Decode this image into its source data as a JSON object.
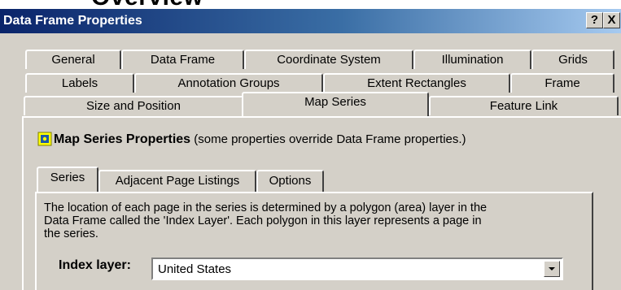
{
  "heading_cut": "Overview",
  "window": {
    "title": "Data Frame Properties",
    "help_label": "?",
    "close_label": "X",
    "title_color": "#0a246a"
  },
  "tabs": {
    "row1": [
      "General",
      "Data Frame",
      "Coordinate System",
      "Illumination",
      "Grids"
    ],
    "row2": [
      "Labels",
      "Annotation Groups",
      "Extent Rectangles",
      "Frame"
    ],
    "row3": [
      "Size and Position",
      "Map Series",
      "Feature Link"
    ],
    "active": "Map Series"
  },
  "map_series": {
    "title_bold": "Map Series Properties",
    "title_note": " (some properties override Data Frame properties.)",
    "subtabs": [
      "Series",
      "Adjacent Page Listings",
      "Options"
    ],
    "active_subtab": "Series",
    "description_lines": [
      "The location of each page in the series is determined by a polygon (area) layer in the",
      "Data Frame called the 'Index Layer'.  Each polygon in this layer represents a page in",
      "the series."
    ],
    "index_layer_label": "Index layer:",
    "index_layer_value": "United States"
  },
  "icons": {
    "map_series": "map-series-icon",
    "dropdown": "chevron-down-icon"
  }
}
